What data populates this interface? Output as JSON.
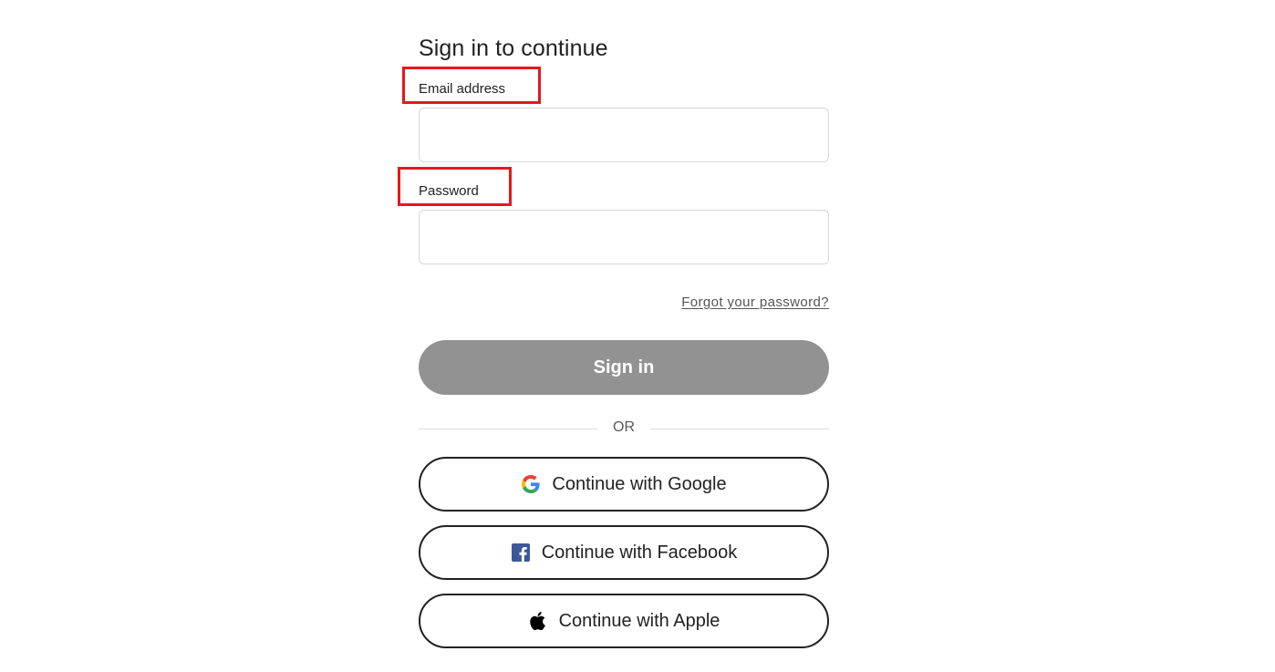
{
  "form": {
    "title": "Sign in to continue",
    "email_label": "Email address",
    "email_value": "",
    "password_label": "Password",
    "password_value": "",
    "forgot_link": "Forgot your password?",
    "signin_label": "Sign in",
    "divider_text": "OR"
  },
  "social": {
    "google_label": "Continue with Google",
    "google_icon": "google-icon",
    "facebook_label": "Continue with Facebook",
    "facebook_icon": "facebook-icon",
    "apple_label": "Continue with Apple",
    "apple_icon": "apple-icon"
  },
  "colors": {
    "highlight_box": "#e8161c",
    "signin_button_bg": "#929292",
    "button_border": "#222222",
    "facebook_blue": "#3b5998"
  }
}
